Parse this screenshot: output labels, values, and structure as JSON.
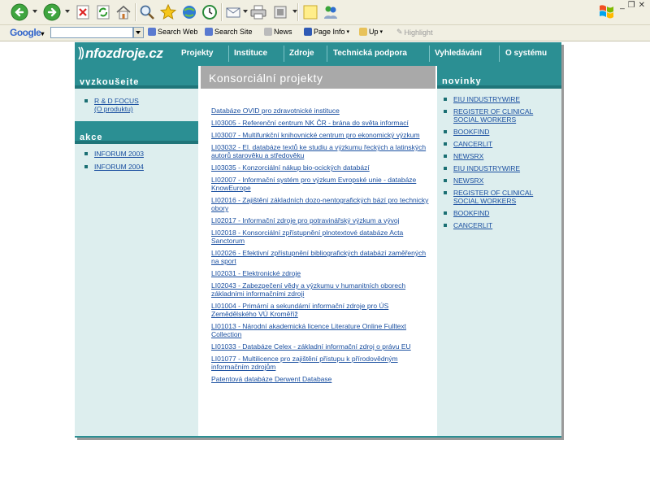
{
  "browser": {
    "google_toolbar": {
      "logo": "Google",
      "search_web": "Search Web",
      "search_site": "Search Site",
      "news": "News",
      "page_info": "Page Info",
      "up": "Up",
      "highlight": "Highlight"
    },
    "icons": [
      "back-icon",
      "forward-icon",
      "stop-icon",
      "refresh-icon",
      "home-icon",
      "search-icon",
      "favorites-icon",
      "media-icon",
      "history-icon",
      "mail-icon",
      "print-icon",
      "edit-icon",
      "notes-icon",
      "messenger-icon"
    ]
  },
  "site": {
    "logo": "nfozdroje.cz",
    "nav": [
      "Projekty",
      "Instituce",
      "Zdroje",
      "Technická podpora",
      "Vyhledávání",
      "O systému"
    ],
    "left": {
      "try_heading": "vyzkoušejte",
      "try_items": [
        "R & D FOCUS",
        "(O produktu)"
      ],
      "actions_heading": "akce",
      "actions_items": [
        "INFORUM 2003",
        "INFORUM 2004"
      ]
    },
    "center": {
      "heading": "Konsorciální projekty",
      "projects": [
        "Databáze OVID pro zdravotnické instituce",
        "LI03005 - Referenční centrum NK ČR - brána do světa informací",
        "LI03007 - Multifunkční knihovnické centrum pro ekonomický výzkum",
        "LI03032 - El. databáze textů ke studiu a výzkumu řeckých a latinských autorů starověku a středověku",
        "LI03035 - Konzorciální nákup bio-ocických databází",
        "LI02007 - Informační systém pro výzkum Evropské unie - databáze KnowEurope",
        "LI02016 - Zajištění základních dozo-nentografických bází pro technicky obory",
        "LI02017 - Informační zdroje pro potravinářský výzkum a vývoj",
        "LI02018 - Konsorciální zpřístupnění plnotextové databáze Acta Sanctorum",
        "LI02026 - Efektivní zpřístupnění bibliografických databází zaměřených na sport",
        "LI02031 - Elektronické zdroje",
        "LI02043 - Zabezpečení vědy a výzkumu v humanitních oborech základními informačními zdroji",
        "LI01004 - Primární a sekundární informační zdroje pro ÚS Zemědělského VÚ Kroměříž",
        "LI01013 - Národní akademická licence Literature Online Fulltext Collection",
        "LI01033 - Databáze Celex - základní informační zdroj o právu EU",
        "LI01077 - Multilicence pro zajištění přístupu k přírodovědným informačním zdrojům",
        "Patentová databáze Derwent Database"
      ]
    },
    "right": {
      "heading": "novinky",
      "items": [
        "EIU INDUSTRYWIRE",
        "REGISTER OF CLINICAL SOCIAL WORKERS",
        "BOOKFIND",
        "CANCERLIT",
        "NEWSRX",
        "EIU INDUSTRYWIRE",
        "NEWSRX",
        "REGISTER OF CLINICAL SOCIAL WORKERS",
        "BOOKFIND",
        "CANCERLIT"
      ]
    }
  },
  "colors": {
    "teal": "#2b8f93",
    "teal_dark": "#1f7579",
    "side_bg": "#ddeeee",
    "link": "#1a4fa0",
    "center_head": "#a9a9a9"
  }
}
